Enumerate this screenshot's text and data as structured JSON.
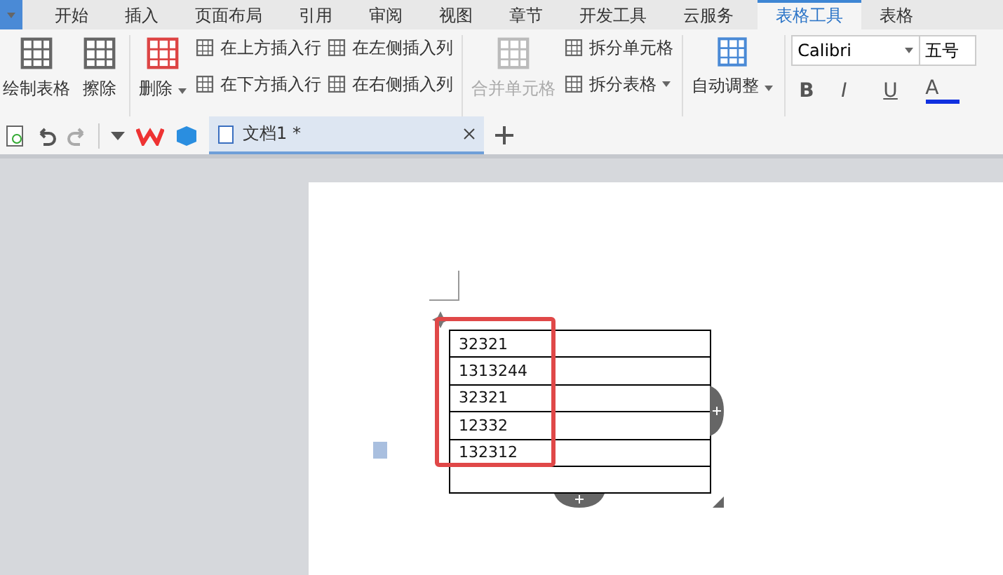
{
  "menu_tabs": [
    {
      "label": "开始",
      "selected": false
    },
    {
      "label": "插入",
      "selected": false
    },
    {
      "label": "页面布局",
      "selected": false
    },
    {
      "label": "引用",
      "selected": false
    },
    {
      "label": "审阅",
      "selected": false
    },
    {
      "label": "视图",
      "selected": false
    },
    {
      "label": "章节",
      "selected": false
    },
    {
      "label": "开发工具",
      "selected": false
    },
    {
      "label": "云服务",
      "selected": false
    },
    {
      "label": "表格工具",
      "selected": true
    },
    {
      "label": "表格",
      "selected": false
    }
  ],
  "ribbon": {
    "draw_table": "绘制表格",
    "eraser": "擦除",
    "delete": "删除",
    "insert_buttons": [
      "在上方插入行",
      "在左侧插入列",
      "在下方插入行",
      "在右侧插入列"
    ],
    "merge_cells": {
      "label": "合并单元格",
      "disabled": true
    },
    "split_cells": "拆分单元格",
    "split_table": "拆分表格",
    "auto_fit": "自动调整",
    "font": "Calibri",
    "font_size": "五号",
    "format_buttons": [
      "B",
      "I",
      "U",
      "A"
    ]
  },
  "doc_tab": {
    "title": "文档1 *"
  },
  "table": {
    "rows": [
      {
        "cell": "32321"
      },
      {
        "cell": "1313244"
      },
      {
        "cell": "32321"
      },
      {
        "cell": "12332"
      },
      {
        "cell": "132312"
      },
      {
        "cell": ""
      }
    ]
  }
}
